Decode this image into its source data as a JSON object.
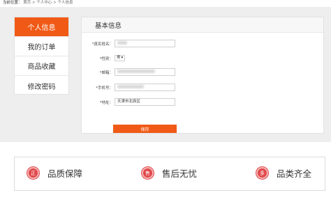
{
  "breadcrumb": {
    "label": "当前位置：",
    "items": [
      "首页",
      "个人中心",
      "个人信息"
    ],
    "sep": " > "
  },
  "sidebar": {
    "items": [
      {
        "label": "个人信息",
        "active": true
      },
      {
        "label": "我的订单",
        "active": false
      },
      {
        "label": "商品收藏",
        "active": false
      },
      {
        "label": "修改密码",
        "active": false
      }
    ]
  },
  "panel": {
    "title": "基本信息",
    "fields": {
      "name_label": "*真实姓名：",
      "gender_label": "*性别：",
      "gender_value": "男",
      "email_label": "*邮箱：",
      "phone_label": "*手机号：",
      "address_label": "*地址：",
      "address_value": "天津市北辰区"
    },
    "save_label": "保存"
  },
  "features": [
    {
      "icon_char": "正",
      "icon": "quality-badge-icon",
      "label": "品质保障"
    },
    {
      "icon_char": "售",
      "icon": "after-sales-badge-icon",
      "label": "售后无忧"
    },
    {
      "icon_char": "多",
      "icon": "variety-badge-icon",
      "label": "品类齐全"
    }
  ],
  "colors": {
    "accent": "#f05a16",
    "badge": "#e0474a"
  }
}
